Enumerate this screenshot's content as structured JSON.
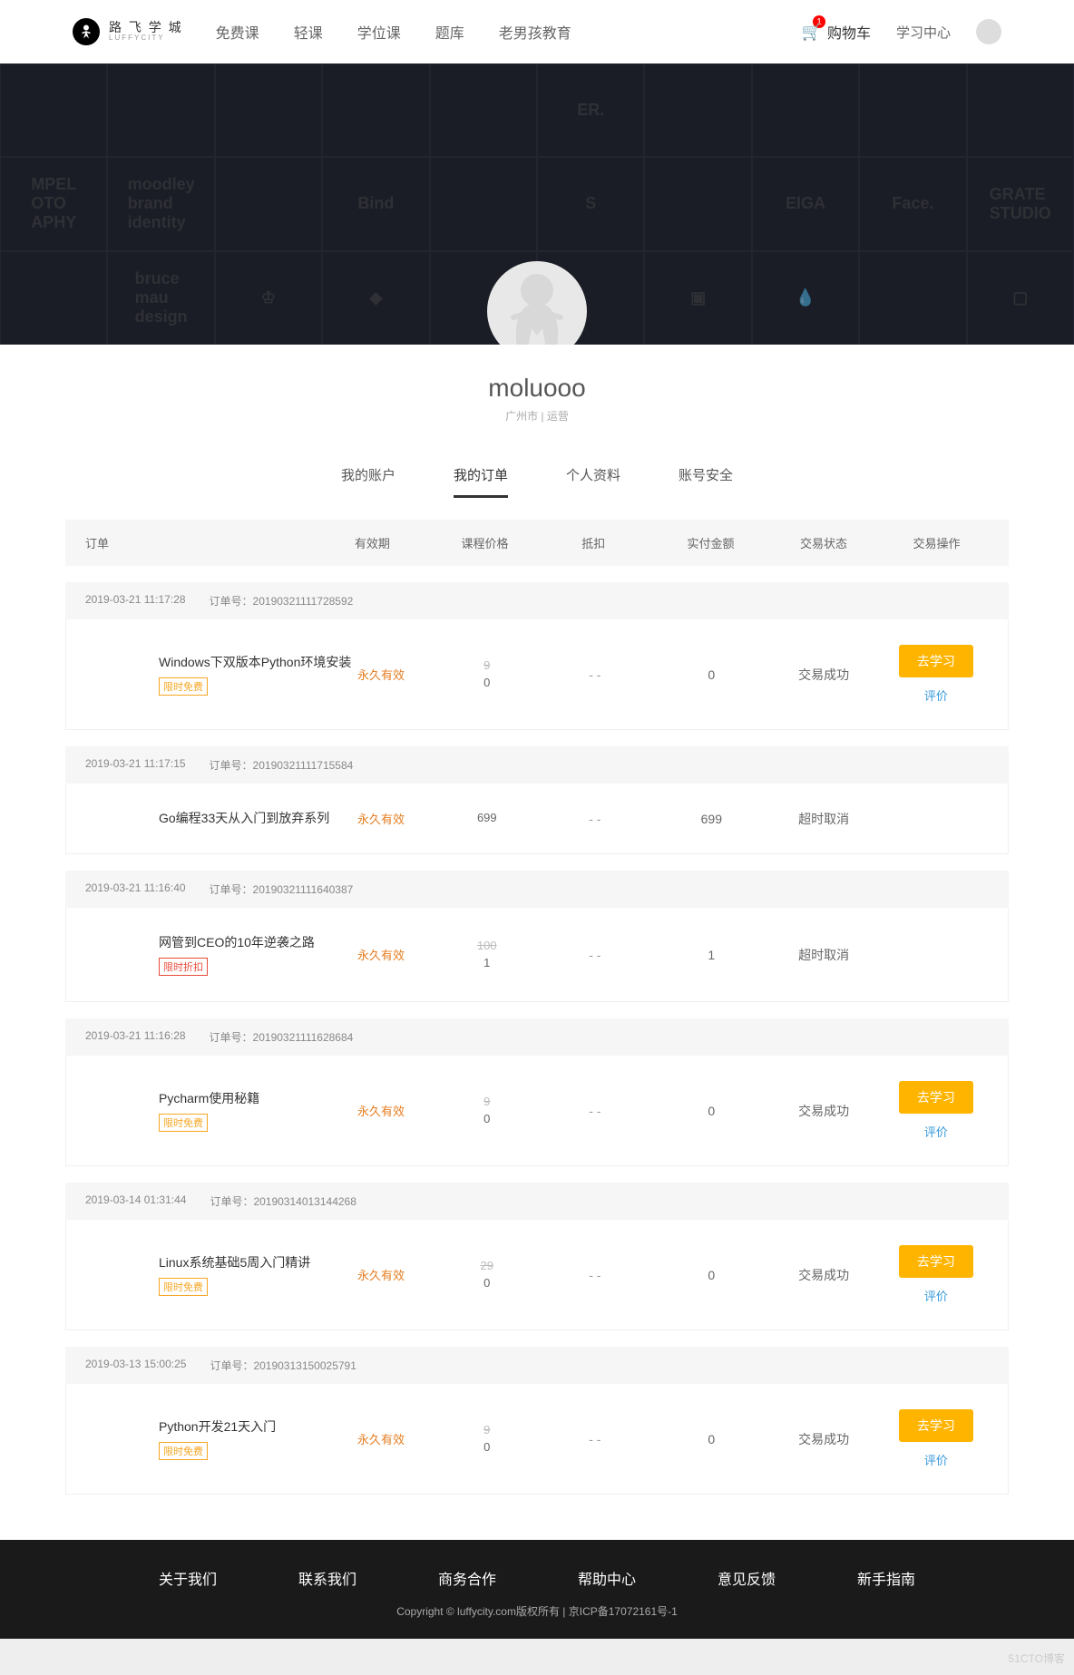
{
  "header": {
    "logo_cn": "路 飞 学 城",
    "logo_en": "LUFFYCITY",
    "nav": [
      "免费课",
      "轻课",
      "学位课",
      "题库",
      "老男孩教育"
    ],
    "cart_label": "购物车",
    "cart_count": "1",
    "learn_center": "学习中心"
  },
  "profile": {
    "username": "moluooo",
    "meta": "广州市 | 运营"
  },
  "tabs": [
    "我的账户",
    "我的订单",
    "个人资料",
    "账号安全"
  ],
  "active_tab": 1,
  "table_head": {
    "order": "订单",
    "valid": "有效期",
    "price": "课程价格",
    "discount": "抵扣",
    "paid": "实付金额",
    "status": "交易状态",
    "action": "交易操作"
  },
  "order_meta_label": "订单号：",
  "btn_study": "去学习",
  "link_rate": "评价",
  "orders": [
    {
      "time": "2019-03-21 11:17:28",
      "number": "20190321111728592",
      "title": "Windows下双版本Python环境安装",
      "badge": "限时免费",
      "badge_class": "",
      "valid": "永久有效",
      "price_thru": "9",
      "price": "0",
      "discount": "- -",
      "paid": "0",
      "status": "交易成功",
      "has_action": true
    },
    {
      "time": "2019-03-21 11:17:15",
      "number": "20190321111715584",
      "title": "Go编程33天从入门到放弃系列",
      "badge": "",
      "badge_class": "",
      "valid": "永久有效",
      "price_thru": "",
      "price": "699",
      "discount": "- -",
      "paid": "699",
      "status": "超时取消",
      "has_action": false
    },
    {
      "time": "2019-03-21 11:16:40",
      "number": "20190321111640387",
      "title": "网管到CEO的10年逆袭之路",
      "badge": "限时折扣",
      "badge_class": "red",
      "valid": "永久有效",
      "price_thru": "100",
      "price": "1",
      "discount": "- -",
      "paid": "1",
      "status": "超时取消",
      "has_action": false
    },
    {
      "time": "2019-03-21 11:16:28",
      "number": "20190321111628684",
      "title": "Pycharm使用秘籍",
      "badge": "限时免费",
      "badge_class": "",
      "valid": "永久有效",
      "price_thru": "9",
      "price": "0",
      "discount": "- -",
      "paid": "0",
      "status": "交易成功",
      "has_action": true
    },
    {
      "time": "2019-03-14 01:31:44",
      "number": "20190314013144268",
      "title": "Linux系统基础5周入门精讲",
      "badge": "限时免费",
      "badge_class": "",
      "valid": "永久有效",
      "price_thru": "29",
      "price": "0",
      "discount": "- -",
      "paid": "0",
      "status": "交易成功",
      "has_action": true
    },
    {
      "time": "2019-03-13 15:00:25",
      "number": "20190313150025791",
      "title": "Python开发21天入门",
      "badge": "限时免费",
      "badge_class": "",
      "valid": "永久有效",
      "price_thru": "9",
      "price": "0",
      "discount": "- -",
      "paid": "0",
      "status": "交易成功",
      "has_action": true
    }
  ],
  "footer": {
    "links": [
      "关于我们",
      "联系我们",
      "商务合作",
      "帮助中心",
      "意见反馈",
      "新手指南"
    ],
    "copyright": "Copyright © luffycity.com版权所有 | 京ICP备17072161号-1"
  },
  "watermark": "51CTO博客"
}
